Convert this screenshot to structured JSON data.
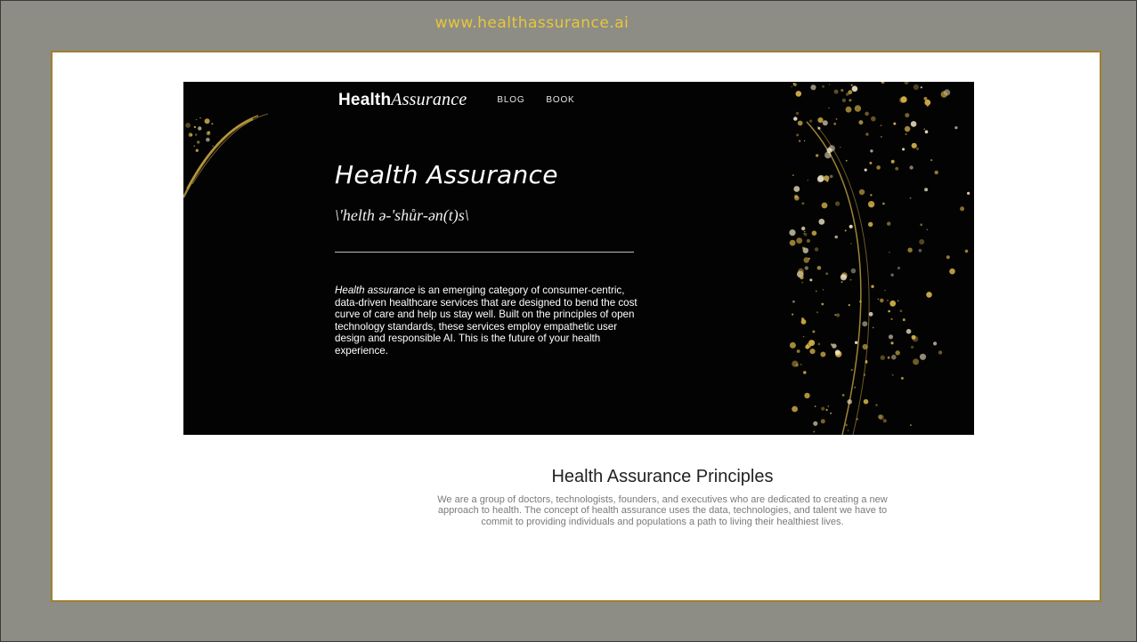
{
  "url_banner": {
    "text": "www.healthassurance.ai"
  },
  "nav": {
    "logo_bold": "Health",
    "logo_italic": "Assurance",
    "links": [
      "BLOG",
      "BOOK"
    ]
  },
  "hero": {
    "title": "Health Assurance",
    "pronunciation": "\\'helth ə-'shůr-ən(t)s\\",
    "description_lead": "Health assurance",
    "description_rest": " is an emerging category of consumer-centric, data-driven healthcare services that are designed to bend the cost curve of care and help us stay well. Built on the principles of open technology standards, these services employ empathetic user design and responsible AI. This is the future of your health experience."
  },
  "principles": {
    "title": "Health Assurance Principles",
    "text": "We are a group of doctors, technologists, founders, and executives who are dedicated to creating a new approach to health. The concept of health assurance uses the data, technologies, and talent we have to commit to providing individuals and populations a path to living their healthiest lives."
  },
  "colors": {
    "outer_background": "#8d8d86",
    "url_text": "#e8c63a",
    "slide_border": "#a0802f",
    "hero_background": "#030303",
    "gold_accent": "#d4b04a"
  }
}
